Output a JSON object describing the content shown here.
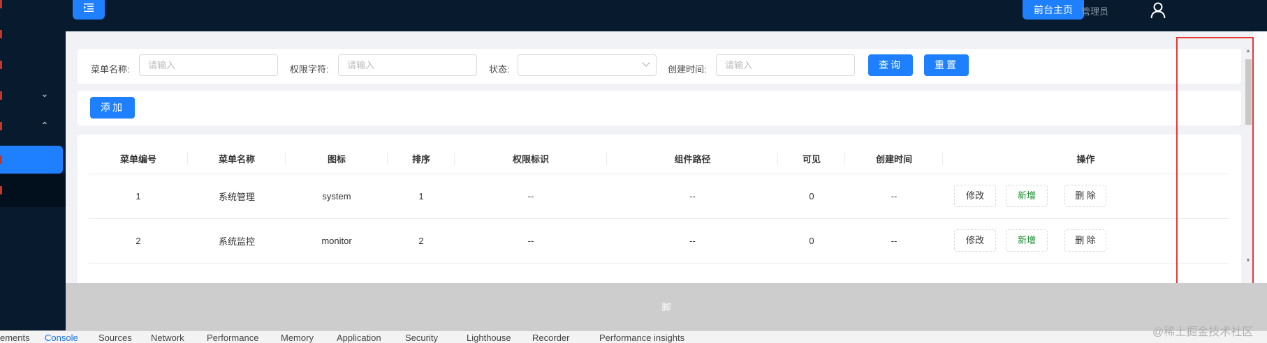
{
  "header": {
    "menu_icon": "indent-icon",
    "front_button": "前台主页",
    "user_text": "管理员"
  },
  "search": {
    "menu_name_label": "菜单名称:",
    "menu_name_placeholder": "请输入",
    "perm_label": "权限字符:",
    "perm_placeholder": "请输入",
    "status_label": "状态:",
    "create_time_label": "创建时间:",
    "create_time_placeholder": "请输入",
    "query_button": "查询",
    "reset_button": "重置"
  },
  "toolbar": {
    "add_button": "添加"
  },
  "table": {
    "columns": [
      "菜单编号",
      "菜单名称",
      "图标",
      "排序",
      "权限标识",
      "组件路径",
      "可见",
      "创建时间",
      "操作"
    ],
    "rows": [
      {
        "id": "1",
        "name": "系统管理",
        "icon": "system",
        "order": "1",
        "perm": "--",
        "path": "--",
        "visible": "0",
        "created": "--"
      },
      {
        "id": "2",
        "name": "系统监控",
        "icon": "monitor",
        "order": "2",
        "perm": "--",
        "path": "--",
        "visible": "0",
        "created": "--"
      }
    ],
    "actions": {
      "edit": "修改",
      "add": "新增",
      "delete": "删 除"
    }
  },
  "footer": {
    "text": "脚"
  },
  "devtools": {
    "tabs": [
      "ements",
      "Console",
      "Sources",
      "Network",
      "Performance",
      "Memory",
      "Application",
      "Security",
      "Lighthouse",
      "Recorder",
      "Performance insights"
    ],
    "active_tab": "Console"
  },
  "watermark": "@稀土掘金技术社区"
}
